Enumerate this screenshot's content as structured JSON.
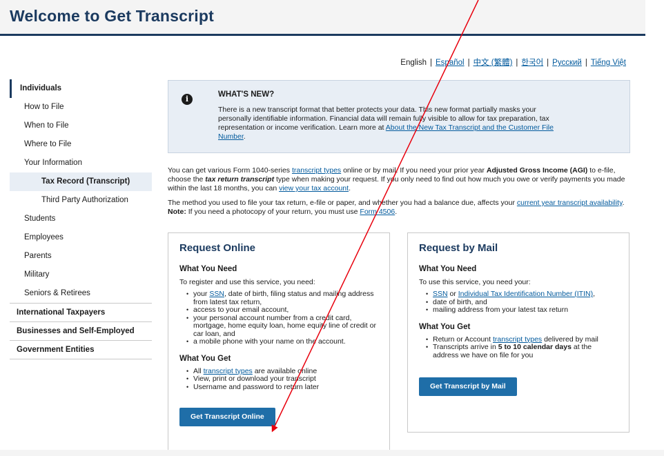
{
  "header": {
    "title": "Welcome to Get Transcript"
  },
  "languages": {
    "current": "English",
    "links": [
      "Español",
      "中文 (繁體)",
      "한국어",
      "Русский",
      "Tiếng Việt"
    ]
  },
  "sidebar": {
    "items": [
      {
        "label": "Individuals",
        "kind": "top"
      },
      {
        "label": "How to File",
        "kind": "item"
      },
      {
        "label": "When to File",
        "kind": "item"
      },
      {
        "label": "Where to File",
        "kind": "item"
      },
      {
        "label": "Your Information",
        "kind": "item"
      },
      {
        "label": "Tax Record (Transcript)",
        "kind": "sub-active"
      },
      {
        "label": "Third Party Authorization",
        "kind": "sub"
      },
      {
        "label": "Students",
        "kind": "item"
      },
      {
        "label": "Employees",
        "kind": "item"
      },
      {
        "label": "Parents",
        "kind": "item"
      },
      {
        "label": "Military",
        "kind": "item"
      },
      {
        "label": "Seniors & Retirees",
        "kind": "item"
      },
      {
        "label": "International Taxpayers",
        "kind": "section"
      },
      {
        "label": "Businesses and Self-Employed",
        "kind": "section"
      },
      {
        "label": "Government Entities",
        "kind": "section"
      }
    ]
  },
  "whats_new": {
    "title": "WHAT'S NEW?",
    "text": "There is a new transcript format that better protects your data. This new format partially masks your personally identifiable information. Financial data will remain fully visible to allow for tax preparation, tax representation or income verification. Learn more at ",
    "link": "About the New Tax Transcript and the Customer File Number",
    "end": "."
  },
  "intro": {
    "p1_a": "You can get various Form 1040-series ",
    "p1_link1": "transcript types",
    "p1_b": " online or by mail. If you need your prior year ",
    "p1_bold1": "Adjusted Gross Income (AGI)",
    "p1_c": " to e-file, choose the ",
    "p1_bold2": "tax return transcript",
    "p1_d": " type when making your request. If you only need to find out how much you owe or verify payments you made within the last 18 months, you can ",
    "p1_link2": "view your tax account",
    "p1_e": ".",
    "p2_a": "The method you used to file your tax return, e-file or paper, and whether you had a balance due, affects your ",
    "p2_link1": "current year transcript availability",
    "p2_b": ". ",
    "p2_bold": "Note:",
    "p2_c": " If you need a photocopy of your return, you must use ",
    "p2_link2": "Form 4506",
    "p2_d": "."
  },
  "online": {
    "title": "Request Online",
    "need_heading": "What You Need",
    "need_intro": "To register and use this service, you need:",
    "need_items": [
      {
        "a": "your ",
        "link": "SSN",
        "b": ", date of birth, filing status and mailing address from latest tax return,"
      },
      {
        "a": "access to your email account,",
        "link": "",
        "b": ""
      },
      {
        "a": "your personal account number from a credit card, mortgage, home equity loan, home equity line of credit or car loan, and",
        "link": "",
        "b": ""
      },
      {
        "a": "a mobile phone with your name on the account.",
        "link": "",
        "b": ""
      }
    ],
    "get_heading": "What You Get",
    "get_items": [
      {
        "a": "All ",
        "link": "transcript types",
        "b": " are available online"
      },
      {
        "a": "View, print or download your transcript",
        "link": "",
        "b": ""
      },
      {
        "a": "Username and password to return later",
        "link": "",
        "b": ""
      }
    ],
    "button": "Get Transcript Online"
  },
  "mail": {
    "title": "Request by Mail",
    "need_heading": "What You Need",
    "need_intro": "To use this service, you need your:",
    "need_items": [
      {
        "a": "",
        "link": "SSN",
        "b": " or ",
        "link2": "Individual Tax Identification Number (ITIN)",
        "c": ","
      },
      {
        "a": "date of birth, and",
        "link": "",
        "b": "",
        "link2": "",
        "c": ""
      },
      {
        "a": "mailing address from your latest tax return",
        "link": "",
        "b": "",
        "link2": "",
        "c": ""
      }
    ],
    "get_heading": "What You Get",
    "get_items": [
      {
        "a": "Return or Account ",
        "link": "transcript types",
        "b": " delivered by mail",
        "bold": "",
        "c": ""
      },
      {
        "a": "Transcripts arrive in ",
        "link": "",
        "b": "",
        "bold": "5 to 10 calendar days",
        "c": " at the address we have on file for you"
      }
    ],
    "button": "Get Transcript by Mail"
  },
  "colors": {
    "navy": "#1b3a5f",
    "link": "#00599c",
    "button": "#1f6ea8",
    "panel": "#e8eef5",
    "annotation": "#e8000d"
  }
}
